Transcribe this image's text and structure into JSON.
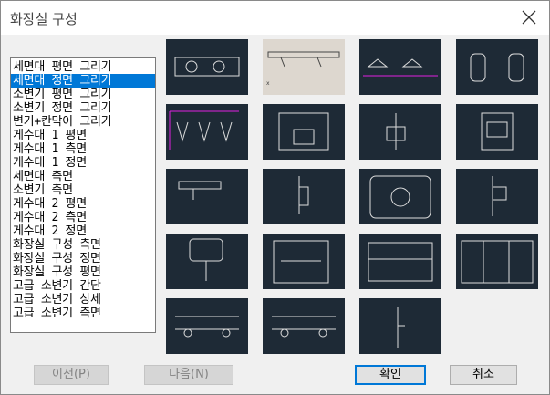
{
  "title": "화장실 구성",
  "list_items": [
    "세면대 평면 그리기",
    "세면대 정면 그리기",
    "소변기 평면 그리기",
    "소변기 정면 그리기",
    "변기+칸막이 그리기",
    "게수대 1 평면",
    "게수대 1 측면",
    "게수대 1 정면",
    "세면대 측면",
    "소변기 측면",
    "게수대 2 평면",
    "게수대 2 측면",
    "게수대 2 정면",
    "화장실 구성 측면",
    "화장실 구성 정면",
    "화장실 구성 평면",
    "고급 소변기 간단",
    "고급 소변기 상세",
    "고급 소변기 측면"
  ],
  "selected_index": 1,
  "buttons": {
    "prev": "이전(P)",
    "next": "다음(N)",
    "ok": "확인",
    "cancel": "취소"
  },
  "colors": {
    "thumb_bg": "#1e2a36",
    "thumb_selected_bg": "#ddd7cf",
    "selection": "#0078d7",
    "magenta": "#e020e0"
  },
  "icons": {
    "close": "close-icon"
  }
}
